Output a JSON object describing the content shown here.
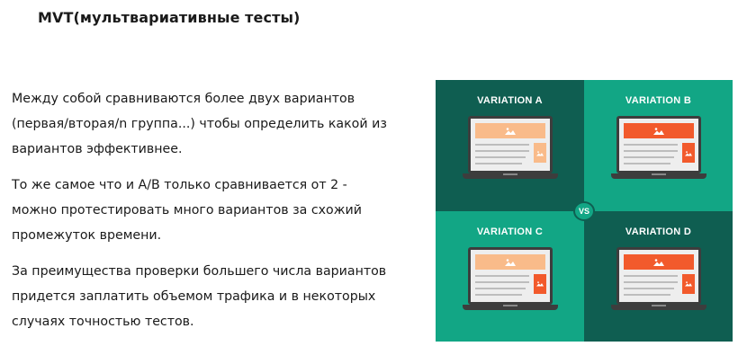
{
  "title": "MVT(мультвариативные тесты)",
  "paragraphs": [
    "Между собой сравниваются более двух вариантов (первая/вторая/n группа...) чтобы определить какой из вариантов эффективнее.",
    "То же самое что и A/B только сравнивается от 2 - можно протестировать много вариантов за схожий промежуток времени.",
    "За преимущества проверки большего числа вариантов придется заплатить объемом трафика и в некоторых случаях точностью тестов."
  ],
  "illustration": {
    "variations": [
      {
        "label": "VARIATION A",
        "accent": "#f9bb8a"
      },
      {
        "label": "VARIATION B",
        "accent": "#f25a2c"
      },
      {
        "label": "VARIATION C",
        "accent": "#f9bb8a"
      },
      {
        "label": "VARIATION D",
        "accent": "#f25a2c"
      }
    ],
    "vs_label": "VS",
    "colors": {
      "dark": "#0f5e51",
      "light": "#12a685"
    },
    "icon": "image-placeholder-icon"
  }
}
